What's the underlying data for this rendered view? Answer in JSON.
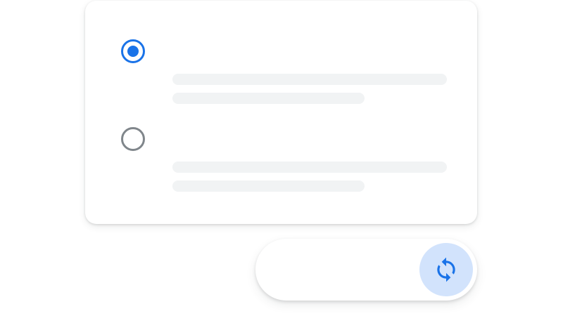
{
  "colors": {
    "accent": "#1a73e8",
    "muted": "#80868b",
    "placeholder": "#f1f3f4",
    "button_bg": "#d2e3fc"
  },
  "options": [
    {
      "state": "selected",
      "icon": "radio-checked-icon"
    },
    {
      "state": "unselected",
      "icon": "radio-unchecked-icon"
    }
  ],
  "sync_button": {
    "icon": "sync-icon"
  }
}
